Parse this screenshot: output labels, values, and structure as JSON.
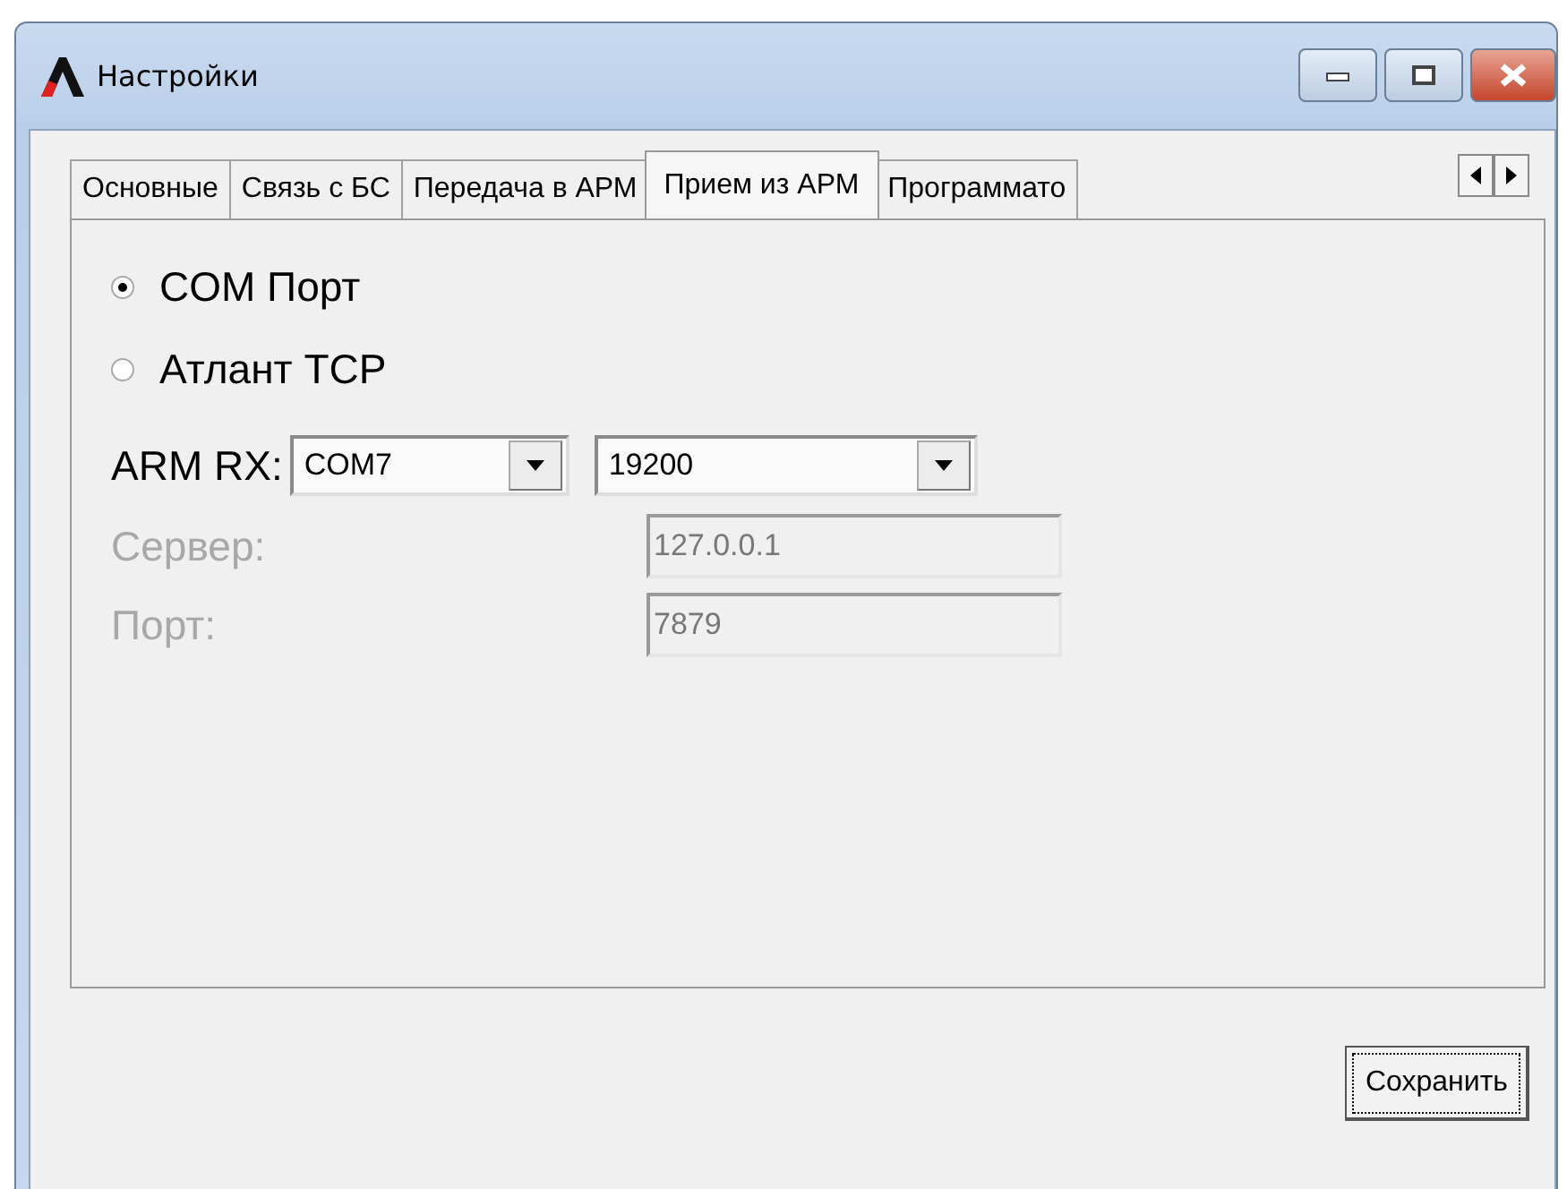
{
  "window": {
    "title": "Настройки"
  },
  "tabs": [
    {
      "label": "Основные",
      "selected": false
    },
    {
      "label": "Связь с БС",
      "selected": false
    },
    {
      "label": "Передача в АРМ",
      "selected": false
    },
    {
      "label": "Прием из АРМ",
      "selected": true
    },
    {
      "label": "Программато",
      "selected": false
    }
  ],
  "radios": [
    {
      "label": "COM Порт",
      "selected": true
    },
    {
      "label": "Атлант TCP",
      "selected": false
    }
  ],
  "arm_rx": {
    "label": "ARM RX:",
    "port": "COM7",
    "baud": "19200"
  },
  "fields": [
    {
      "label": "Сервер:",
      "value": "127.0.0.1",
      "disabled": true
    },
    {
      "label": "Порт:",
      "value": "7879",
      "disabled": true
    }
  ],
  "buttons": [
    "Сохранить"
  ]
}
